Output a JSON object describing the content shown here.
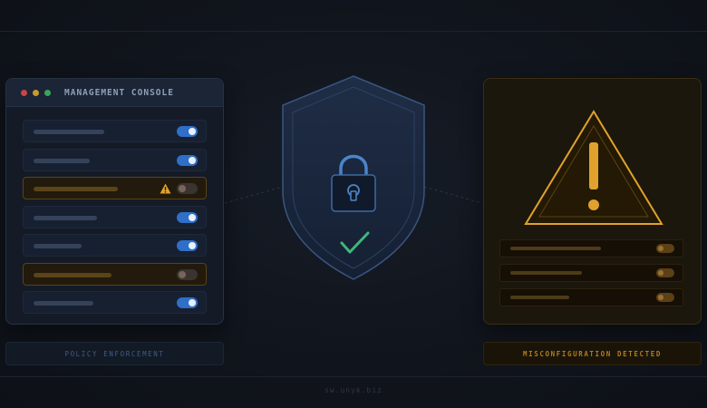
{
  "console": {
    "title": "MANAGEMENT CONSOLE",
    "rows": [
      {
        "enabled": true,
        "warning": false
      },
      {
        "enabled": true,
        "warning": false
      },
      {
        "enabled": false,
        "warning": true
      },
      {
        "enabled": true,
        "warning": false
      },
      {
        "enabled": true,
        "warning": false
      },
      {
        "enabled": false,
        "warning": true
      },
      {
        "enabled": true,
        "warning": false
      }
    ],
    "caption": "POLICY ENFORCEMENT"
  },
  "shield": {
    "icon": "padlock-icon",
    "status_icon": "checkmark-icon"
  },
  "alert": {
    "icon": "warning-triangle-icon",
    "rows": [
      {
        "enabled": false
      },
      {
        "enabled": false
      },
      {
        "enabled": false
      }
    ],
    "caption": "MISCONFIGURATION DETECTED"
  },
  "footer": {
    "text": "sw.unyk.biz"
  },
  "colors": {
    "accent_blue": "#2f6fc8",
    "warning_amber": "#e0a22c",
    "success_green": "#3fb67a"
  }
}
